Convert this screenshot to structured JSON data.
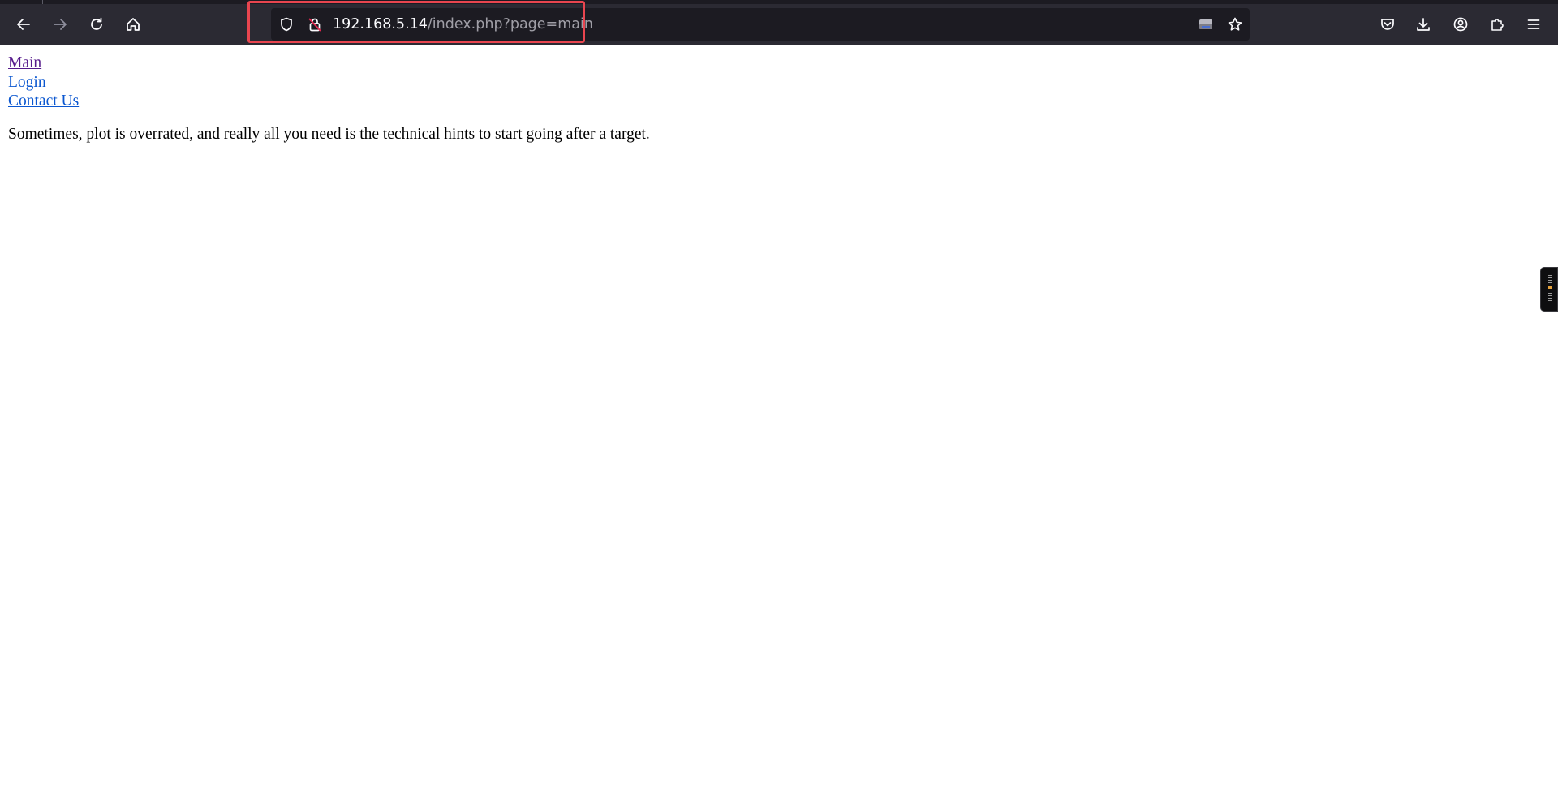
{
  "browser": {
    "url_host": "192.168.5.14",
    "url_path": "/index.php?page=main",
    "icons": {
      "back": "back-arrow-icon",
      "forward": "forward-arrow-icon",
      "reload": "reload-icon",
      "home": "home-icon",
      "tracking": "shield-icon",
      "insecure": "insecure-lock-icon",
      "reader": "reader-mode-icon",
      "bookmark": "star-icon",
      "pocket": "pocket-icon",
      "downloads": "download-icon",
      "account": "account-icon",
      "extensions": "extensions-icon",
      "menu": "hamburger-menu-icon"
    },
    "highlight_color": "#e8454f"
  },
  "page": {
    "nav_links": [
      {
        "label": "Main",
        "visited": true
      },
      {
        "label": "Login",
        "visited": false
      },
      {
        "label": "Contact Us",
        "visited": false
      }
    ],
    "intro_text": "Sometimes, plot is overrated, and really all you need is the technical hints to start going after a target."
  }
}
